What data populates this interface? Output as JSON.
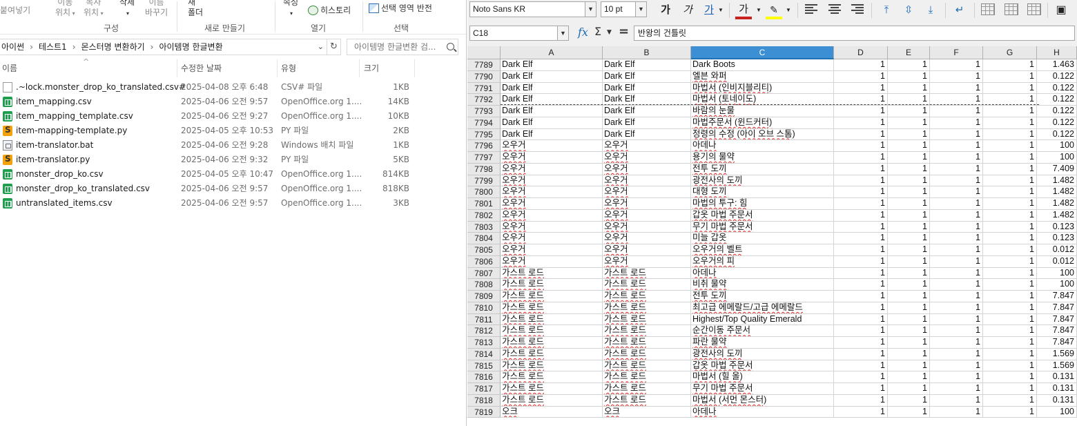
{
  "explorer": {
    "ribbon": {
      "paste_label": "붙여넣기",
      "move_label": [
        "이동",
        "위치"
      ],
      "copy_label": [
        "복사",
        "위치"
      ],
      "delete_label": "삭제",
      "rename_label": [
        "이름",
        "바꾸기"
      ],
      "new_label": [
        "새",
        "폴더"
      ],
      "properties_label": "속성",
      "history_label": "히스토리",
      "invert_label": "선택 영역 반전",
      "groups": {
        "organize": "구성",
        "new": "새로 만들기",
        "open": "열기",
        "select": "선택"
      }
    },
    "address": {
      "crumbs": [
        "아이썬",
        "테스트1",
        "몬스터명 변환하기",
        "아이템명 한글변환"
      ]
    },
    "search": {
      "placeholder": "아이템명 한글변환 검..."
    },
    "columns": {
      "name": "이름",
      "modified": "수정한 날짜",
      "type": "유형",
      "size": "크기"
    },
    "files": [
      {
        "icon": "doc",
        "name": ".~lock.monster_drop_ko_translated.csv#",
        "date": "2025-04-08 오후 6:48",
        "type": "CSV# 파일",
        "size": "1KB"
      },
      {
        "icon": "csv",
        "name": "item_mapping.csv",
        "date": "2025-04-06 오전 9:57",
        "type": "OpenOffice.org 1....",
        "size": "14KB"
      },
      {
        "icon": "csv",
        "name": "item_mapping_template.csv",
        "date": "2025-04-06 오전 9:27",
        "type": "OpenOffice.org 1....",
        "size": "10KB"
      },
      {
        "icon": "py",
        "name": "item-mapping-template.py",
        "date": "2025-04-05 오후 10:53",
        "type": "PY 파일",
        "size": "2KB"
      },
      {
        "icon": "bat",
        "name": "item-translator.bat",
        "date": "2025-04-06 오전 9:28",
        "type": "Windows 배치 파일",
        "size": "1KB"
      },
      {
        "icon": "py",
        "name": "item-translator.py",
        "date": "2025-04-06 오전 9:32",
        "type": "PY 파일",
        "size": "5KB"
      },
      {
        "icon": "csv",
        "name": "monster_drop_ko.csv",
        "date": "2025-04-05 오후 10:47",
        "type": "OpenOffice.org 1....",
        "size": "814KB"
      },
      {
        "icon": "csv",
        "name": "monster_drop_ko_translated.csv",
        "date": "2025-04-06 오전 9:57",
        "type": "OpenOffice.org 1....",
        "size": "818KB"
      },
      {
        "icon": "csv",
        "name": "untranslated_items.csv",
        "date": "2025-04-06 오전 9:57",
        "type": "OpenOffice.org 1....",
        "size": "3KB"
      }
    ]
  },
  "calc": {
    "toolbar": {
      "font_name": "Noto Sans KR",
      "font_size": "10 pt",
      "bold": "가",
      "italic": "가",
      "underline": "가",
      "font_color": "가",
      "font_color_hex": "#c9211e",
      "highlight_hex": "#ffff00"
    },
    "formula_bar": {
      "cell_ref": "C18",
      "fx": "fx",
      "sum": "Σ",
      "equals": "=",
      "content": "반왕의 건틀릿"
    },
    "columns": [
      "A",
      "B",
      "C",
      "D",
      "E",
      "F",
      "G",
      "H"
    ],
    "selected_column": "C",
    "rows": [
      {
        "n": "7789",
        "a": "Dark Elf",
        "b": "Dark Elf",
        "c": "Dark Boots",
        "d": "1",
        "e": "1",
        "f": "1",
        "g": "1",
        "h": "1.463"
      },
      {
        "n": "7790",
        "a": "Dark Elf",
        "b": "Dark Elf",
        "c": "엘븐 와퍼",
        "d": "1",
        "e": "1",
        "f": "1",
        "g": "1",
        "h": "0.122"
      },
      {
        "n": "7791",
        "a": "Dark Elf",
        "b": "Dark Elf",
        "c": "마법서 (인비지블리티)",
        "d": "1",
        "e": "1",
        "f": "1",
        "g": "1",
        "h": "0.122"
      },
      {
        "n": "7792",
        "a": "Dark Elf",
        "b": "Dark Elf",
        "c": "마법서 (토네이도)",
        "d": "1",
        "e": "1",
        "f": "1",
        "g": "1",
        "h": "0.122"
      },
      {
        "n": "7793",
        "a": "Dark Elf",
        "b": "Dark Elf",
        "c": "바람의 눈물",
        "d": "1",
        "e": "1",
        "f": "1",
        "g": "1",
        "h": "0.122"
      },
      {
        "n": "7794",
        "a": "Dark Elf",
        "b": "Dark Elf",
        "c": "마법주문서 (윈드커터)",
        "d": "1",
        "e": "1",
        "f": "1",
        "g": "1",
        "h": "0.122"
      },
      {
        "n": "7795",
        "a": "Dark Elf",
        "b": "Dark Elf",
        "c": "정령의 수정 (아이 오브 스톰)",
        "d": "1",
        "e": "1",
        "f": "1",
        "g": "1",
        "h": "0.122"
      },
      {
        "n": "7796",
        "a": "오우거",
        "b": "오우거",
        "c": "아데나",
        "d": "1",
        "e": "1",
        "f": "1",
        "g": "1",
        "h": "100"
      },
      {
        "n": "7797",
        "a": "오우거",
        "b": "오우거",
        "c": "용기의 물약",
        "d": "1",
        "e": "1",
        "f": "1",
        "g": "1",
        "h": "100"
      },
      {
        "n": "7798",
        "a": "오우거",
        "b": "오우거",
        "c": "전투 도끼",
        "d": "1",
        "e": "1",
        "f": "1",
        "g": "1",
        "h": "7.409"
      },
      {
        "n": "7799",
        "a": "오우거",
        "b": "오우거",
        "c": "광전사의 도끼",
        "d": "1",
        "e": "1",
        "f": "1",
        "g": "1",
        "h": "1.482"
      },
      {
        "n": "7800",
        "a": "오우거",
        "b": "오우거",
        "c": "대형 도끼",
        "d": "1",
        "e": "1",
        "f": "1",
        "g": "1",
        "h": "1.482"
      },
      {
        "n": "7801",
        "a": "오우거",
        "b": "오우거",
        "c": "마법의 투구: 힘",
        "d": "1",
        "e": "1",
        "f": "1",
        "g": "1",
        "h": "1.482"
      },
      {
        "n": "7802",
        "a": "오우거",
        "b": "오우거",
        "c": "갑옷 마법 주문서",
        "d": "1",
        "e": "1",
        "f": "1",
        "g": "1",
        "h": "1.482"
      },
      {
        "n": "7803",
        "a": "오우거",
        "b": "오우거",
        "c": "무기 마법 주문서",
        "d": "1",
        "e": "1",
        "f": "1",
        "g": "1",
        "h": "0.123"
      },
      {
        "n": "7804",
        "a": "오우거",
        "b": "오우거",
        "c": "미늘 갑옷",
        "d": "1",
        "e": "1",
        "f": "1",
        "g": "1",
        "h": "0.123"
      },
      {
        "n": "7805",
        "a": "오우거",
        "b": "오우거",
        "c": "오우거의 벨트",
        "d": "1",
        "e": "1",
        "f": "1",
        "g": "1",
        "h": "0.012"
      },
      {
        "n": "7806",
        "a": "오우거",
        "b": "오우거",
        "c": "오우거의 피",
        "d": "1",
        "e": "1",
        "f": "1",
        "g": "1",
        "h": "0.012"
      },
      {
        "n": "7807",
        "a": "가스트 로드",
        "b": "가스트 로드",
        "c": "아데나",
        "d": "1",
        "e": "1",
        "f": "1",
        "g": "1",
        "h": "100"
      },
      {
        "n": "7808",
        "a": "가스트 로드",
        "b": "가스트 로드",
        "c": "비취 물약",
        "d": "1",
        "e": "1",
        "f": "1",
        "g": "1",
        "h": "100"
      },
      {
        "n": "7809",
        "a": "가스트 로드",
        "b": "가스트 로드",
        "c": "전투 도끼",
        "d": "1",
        "e": "1",
        "f": "1",
        "g": "1",
        "h": "7.847"
      },
      {
        "n": "7810",
        "a": "가스트 로드",
        "b": "가스트 로드",
        "c": "최고급 에메랄드/고급 에메랄드",
        "d": "1",
        "e": "1",
        "f": "1",
        "g": "1",
        "h": "7.847"
      },
      {
        "n": "7811",
        "a": "가스트 로드",
        "b": "가스트 로드",
        "c": "Highest/Top Quality Emerald",
        "d": "1",
        "e": "1",
        "f": "1",
        "g": "1",
        "h": "7.847"
      },
      {
        "n": "7812",
        "a": "가스트 로드",
        "b": "가스트 로드",
        "c": "순간이동 주문서",
        "d": "1",
        "e": "1",
        "f": "1",
        "g": "1",
        "h": "7.847"
      },
      {
        "n": "7813",
        "a": "가스트 로드",
        "b": "가스트 로드",
        "c": "파란 물약",
        "d": "1",
        "e": "1",
        "f": "1",
        "g": "1",
        "h": "7.847"
      },
      {
        "n": "7814",
        "a": "가스트 로드",
        "b": "가스트 로드",
        "c": "광전사의 도끼",
        "d": "1",
        "e": "1",
        "f": "1",
        "g": "1",
        "h": "1.569"
      },
      {
        "n": "7815",
        "a": "가스트 로드",
        "b": "가스트 로드",
        "c": "갑옷 마법 주문서",
        "d": "1",
        "e": "1",
        "f": "1",
        "g": "1",
        "h": "1.569"
      },
      {
        "n": "7816",
        "a": "가스트 로드",
        "b": "가스트 로드",
        "c": "마법서 (힐 올)",
        "d": "1",
        "e": "1",
        "f": "1",
        "g": "1",
        "h": "0.131"
      },
      {
        "n": "7817",
        "a": "가스트 로드",
        "b": "가스트 로드",
        "c": "무기 마법 주문서",
        "d": "1",
        "e": "1",
        "f": "1",
        "g": "1",
        "h": "0.131"
      },
      {
        "n": "7818",
        "a": "가스트 로드",
        "b": "가스트 로드",
        "c": "마법서 (서먼 몬스터)",
        "d": "1",
        "e": "1",
        "f": "1",
        "g": "1",
        "h": "0.131"
      },
      {
        "n": "7819",
        "a": "오크",
        "b": "오크",
        "c": "아데나",
        "d": "1",
        "e": "1",
        "f": "1",
        "g": "1",
        "h": "100"
      }
    ]
  }
}
